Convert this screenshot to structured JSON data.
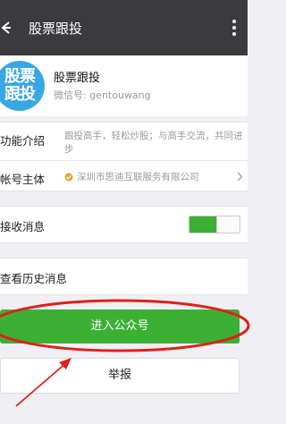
{
  "header": {
    "title": "股票跟投"
  },
  "profile": {
    "avatar_text_line1": "股票",
    "avatar_text_line2": "跟投",
    "name": "股票跟投",
    "wechat_id": "微信号: gentouwang"
  },
  "info": {
    "intro_label": "功能介绍",
    "intro_value": "跟投高手，轻松炒股；与高手交流，共同进步",
    "owner_label": "帐号主体",
    "owner_value": "深圳市思迪互联服务有限公司"
  },
  "receive": {
    "label": "接收消息",
    "enabled": true
  },
  "history": {
    "label": "查看历史消息"
  },
  "actions": {
    "enter_label": "进入公众号",
    "report_label": "举报"
  },
  "colors": {
    "header_bg": "#3a3a3f",
    "accent_green": "#3cb034",
    "avatar_blue": "#38a7e4",
    "annotation_red": "#e0201a"
  }
}
